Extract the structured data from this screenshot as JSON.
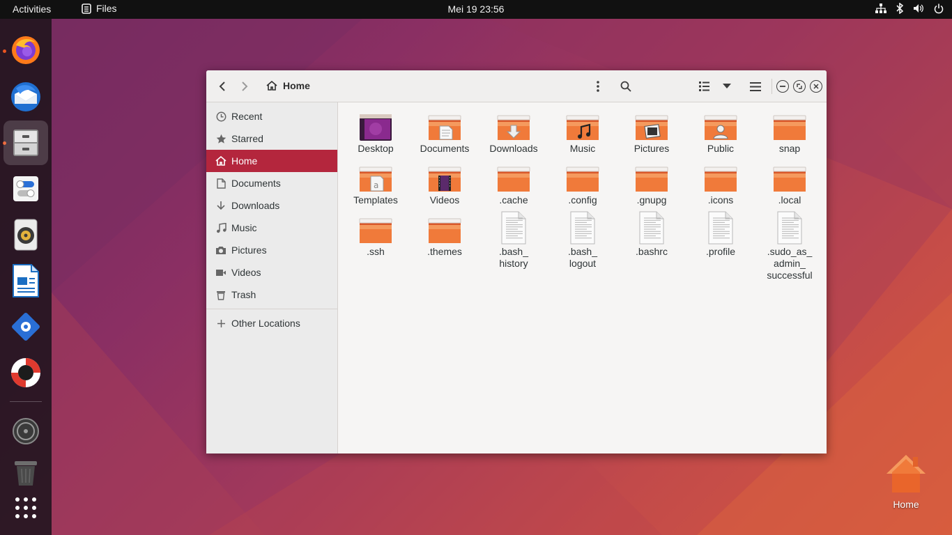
{
  "topbar": {
    "activities": "Activities",
    "app_name": "Files",
    "clock": "Mei 19  23:56"
  },
  "dock": {
    "items": [
      {
        "name": "firefox",
        "running": true
      },
      {
        "name": "thunderbird",
        "running": false
      },
      {
        "name": "files",
        "running": true,
        "active": true
      },
      {
        "name": "settings",
        "running": false
      },
      {
        "name": "rhythmbox",
        "running": false
      },
      {
        "name": "libreoffice-writer",
        "running": false
      },
      {
        "name": "software",
        "running": false
      },
      {
        "name": "help",
        "running": false
      },
      {
        "name": "disks",
        "running": false
      },
      {
        "name": "trash",
        "running": false
      },
      {
        "name": "show-applications",
        "running": false
      }
    ]
  },
  "window": {
    "path_label": "Home",
    "sidebar": {
      "items": [
        {
          "label": "Recent",
          "icon": "clock-icon"
        },
        {
          "label": "Starred",
          "icon": "star-icon"
        },
        {
          "label": "Home",
          "icon": "home-icon",
          "selected": true
        },
        {
          "label": "Documents",
          "icon": "document-icon"
        },
        {
          "label": "Downloads",
          "icon": "download-icon"
        },
        {
          "label": "Music",
          "icon": "music-icon"
        },
        {
          "label": "Pictures",
          "icon": "camera-icon"
        },
        {
          "label": "Videos",
          "icon": "video-icon"
        },
        {
          "label": "Trash",
          "icon": "trash-icon"
        }
      ],
      "other_locations": "Other Locations"
    },
    "files": [
      {
        "label": "Desktop",
        "kind": "desktop"
      },
      {
        "label": "Documents",
        "kind": "documents"
      },
      {
        "label": "Downloads",
        "kind": "downloads"
      },
      {
        "label": "Music",
        "kind": "music"
      },
      {
        "label": "Pictures",
        "kind": "pictures"
      },
      {
        "label": "Public",
        "kind": "public"
      },
      {
        "label": "snap",
        "kind": "folder"
      },
      {
        "label": "Templates",
        "kind": "templates"
      },
      {
        "label": "Videos",
        "kind": "videos"
      },
      {
        "label": ".cache",
        "kind": "folder"
      },
      {
        "label": ".config",
        "kind": "folder"
      },
      {
        "label": ".gnupg",
        "kind": "folder"
      },
      {
        "label": ".icons",
        "kind": "folder"
      },
      {
        "label": ".local",
        "kind": "folder"
      },
      {
        "label": ".ssh",
        "kind": "folder"
      },
      {
        "label": ".themes",
        "kind": "folder"
      },
      {
        "label": ".bash_\nhistory",
        "kind": "text"
      },
      {
        "label": ".bash_\nlogout",
        "kind": "text"
      },
      {
        "label": ".bashrc",
        "kind": "text"
      },
      {
        "label": ".profile",
        "kind": "text"
      },
      {
        "label": ".sudo_as_\nadmin_\nsuccessful",
        "kind": "text"
      }
    ]
  },
  "desktop": {
    "home_label": "Home"
  },
  "colors": {
    "accent": "#b4263d",
    "folder_orange": "#e95420",
    "topbar": "#111111"
  }
}
